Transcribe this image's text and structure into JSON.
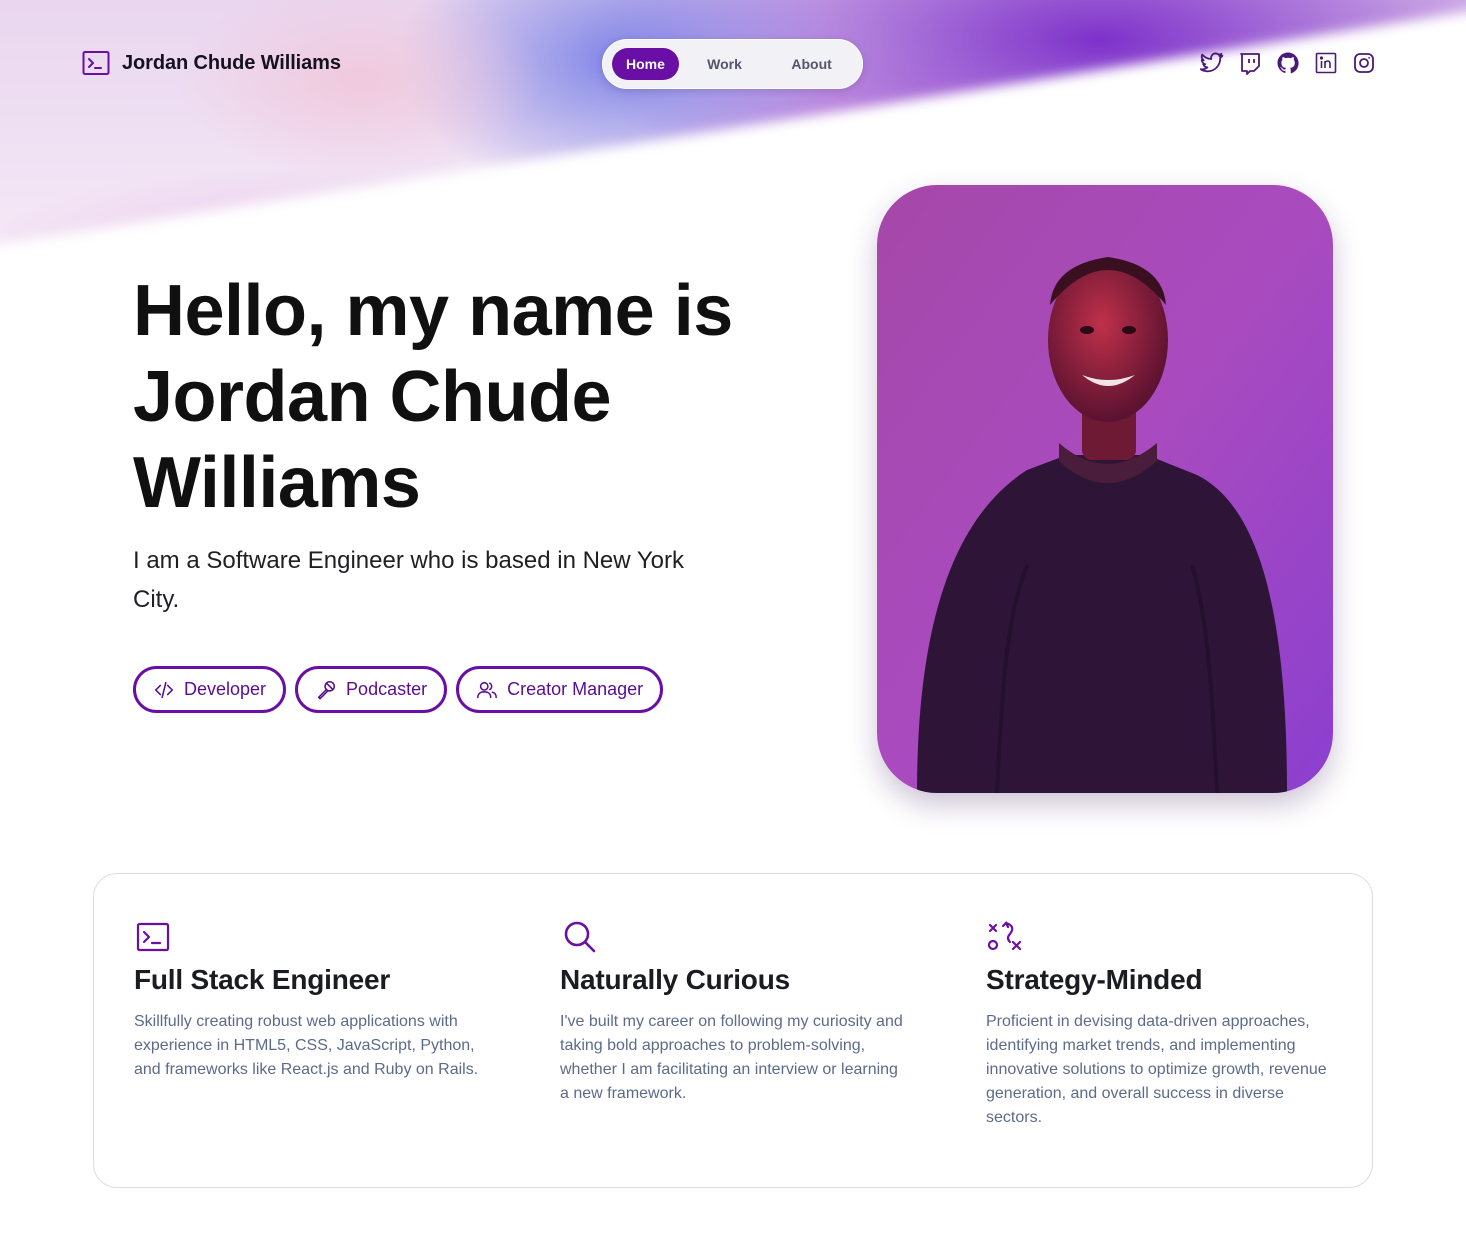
{
  "header": {
    "brand_name": "Jordan Chude Williams",
    "nav": [
      {
        "label": "Home",
        "active": true
      },
      {
        "label": "Work",
        "active": false
      },
      {
        "label": "About",
        "active": false
      }
    ],
    "socials": [
      "twitter-icon",
      "twitch-icon",
      "github-icon",
      "linkedin-icon",
      "instagram-icon"
    ]
  },
  "hero": {
    "title": "Hello, my name is Jordan Chude Williams",
    "subtitle": "I am a Software Engineer who is based in New York City.",
    "chips": [
      {
        "label": "Developer",
        "icon": "code-icon"
      },
      {
        "label": "Podcaster",
        "icon": "microphone-icon"
      },
      {
        "label": "Creator Manager",
        "icon": "users-icon"
      }
    ]
  },
  "features": [
    {
      "icon": "terminal-icon",
      "title": "Full Stack Engineer",
      "text": "Skillfully creating robust web applications with experience in HTML5, CSS, JavaScript, Python, and frameworks like React.js and Ruby on Rails."
    },
    {
      "icon": "magnifier-icon",
      "title": "Naturally Curious",
      "text": "I've built my career on following my curiosity and taking bold approaches to problem-solving, whether I am facilitating an interview or learning a new framework."
    },
    {
      "icon": "strategy-icon",
      "title": "Strategy-Minded",
      "text": "Proficient in devising data-driven approaches, identifying market trends, and implementing innovative solutions to optimize growth, revenue generation, and overall success in diverse sectors."
    }
  ],
  "colors": {
    "accent": "#6a0fa5",
    "text": "#101010",
    "muted": "#5c6b8a"
  }
}
